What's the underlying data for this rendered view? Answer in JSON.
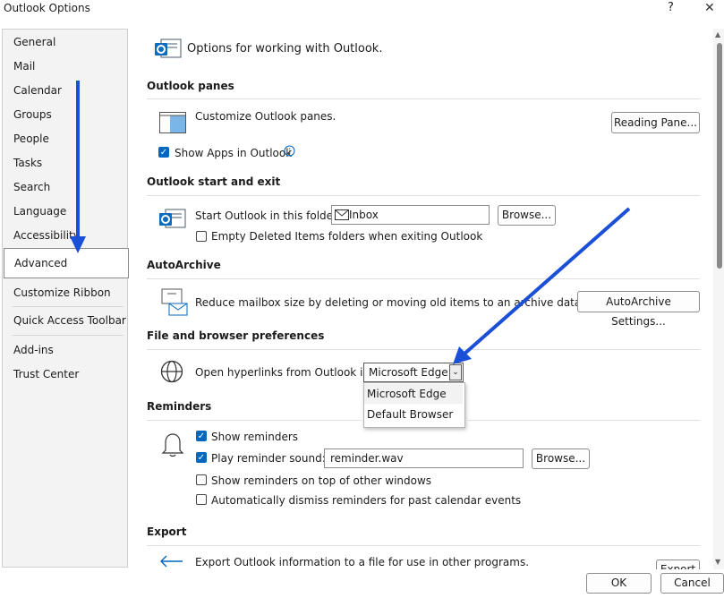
{
  "window": {
    "title": "Outlook Options",
    "help": "?",
    "close": "✕"
  },
  "sidebar": {
    "items": [
      "General",
      "Mail",
      "Calendar",
      "Groups",
      "People",
      "Tasks",
      "Search",
      "Language",
      "Accessibility",
      "Advanced",
      "Customize Ribbon",
      "Quick Access Toolbar",
      "Add-ins",
      "Trust Center"
    ],
    "selected": "Advanced"
  },
  "header": {
    "text": "Options for working with Outlook."
  },
  "panes": {
    "title": "Outlook panes",
    "desc": "Customize Outlook panes.",
    "button": "Reading Pane...",
    "show_apps": "Show Apps in Outlook"
  },
  "start_exit": {
    "title": "Outlook start and exit",
    "label": "Start Outlook in this folder:",
    "folder": "Inbox",
    "browse": "Browse...",
    "empty_deleted": "Empty Deleted Items folders when exiting Outlook"
  },
  "autoarchive": {
    "title": "AutoArchive",
    "desc": "Reduce mailbox size by deleting or moving old items to an archive data file.",
    "button": "AutoArchive Settings..."
  },
  "browser": {
    "title": "File and browser preferences",
    "label": "Open hyperlinks from Outlook in:",
    "selected": "Microsoft Edge",
    "options": [
      "Microsoft Edge",
      "Default Browser"
    ]
  },
  "reminders": {
    "title": "Reminders",
    "show": "Show reminders",
    "play": "Play reminder sound:",
    "sound_file": "reminder.wav",
    "browse": "Browse...",
    "on_top": "Show reminders on top of other windows",
    "auto_dismiss": "Automatically dismiss reminders for past calendar events"
  },
  "export": {
    "title": "Export",
    "desc": "Export Outlook information to a file for use in other programs.",
    "button": "Export"
  },
  "footer": {
    "ok": "OK",
    "cancel": "Cancel"
  },
  "colors": {
    "accent": "#0067c0",
    "arrow": "#1a4fd8"
  }
}
